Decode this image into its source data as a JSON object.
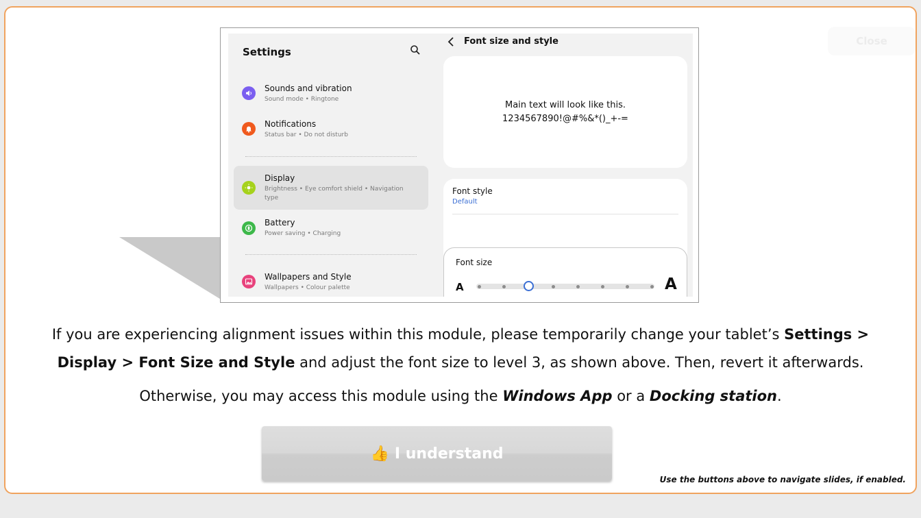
{
  "ghost_button": {
    "label": "Close"
  },
  "screenshot": {
    "left_pane": {
      "title": "Settings",
      "items": [
        {
          "title": "Sounds and vibration",
          "subtitle": "Sound mode  •  Ringtone",
          "icon": "speaker-icon",
          "color": "#7b5ff0"
        },
        {
          "title": "Notifications",
          "subtitle": "Status bar  •  Do not disturb",
          "icon": "bell-icon",
          "color": "#f05a1e"
        },
        {
          "title": "Display",
          "subtitle_line1": "Brightness  •  Eye comfort shield  •  Navigation",
          "subtitle_line2": "type",
          "icon": "sun-icon",
          "color": "#a6d21c"
        },
        {
          "title": "Battery",
          "subtitle": "Power saving  •  Charging",
          "icon": "battery-icon",
          "color": "#3db84a"
        },
        {
          "title": "Wallpapers and Style",
          "subtitle": "Wallpapers  •  Colour palette",
          "icon": "image-icon",
          "color": "#e8427c"
        }
      ]
    },
    "right_pane": {
      "title": "Font size and style",
      "preview_line1": "Main text will look like this.",
      "preview_line2": "1234567890!@#%&*()_+-=",
      "font_style_label": "Font style",
      "font_style_value": "Default",
      "font_size_label": "Font size",
      "size_small_glyph": "A",
      "size_large_glyph": "A",
      "slider_steps": 8,
      "slider_selected_level": 3,
      "accent_color": "#3b6fd4"
    }
  },
  "message": {
    "line1_text": "If you are experiencing alignment issues within this module, please temporarily change your tablet’s ",
    "line1_bold": "Settings >",
    "line2_bold": "Display > Font Size and Style",
    "line2_text": " and adjust the font size to level 3, as shown above. Then, revert it afterwards.",
    "line3_text1": "Otherwise, you may access this module using the ",
    "line3_bold1": "Windows App",
    "line3_text2": " or a ",
    "line3_bold2": "Docking station",
    "line3_text3": "."
  },
  "understand_button": {
    "label": "I understand",
    "icon": "thumbs-up-icon"
  },
  "hint": "Use the buttons above to navigate slides, if enabled.",
  "colors": {
    "frame_border": "#f0a35e",
    "page_bg": "#ebebeb"
  }
}
